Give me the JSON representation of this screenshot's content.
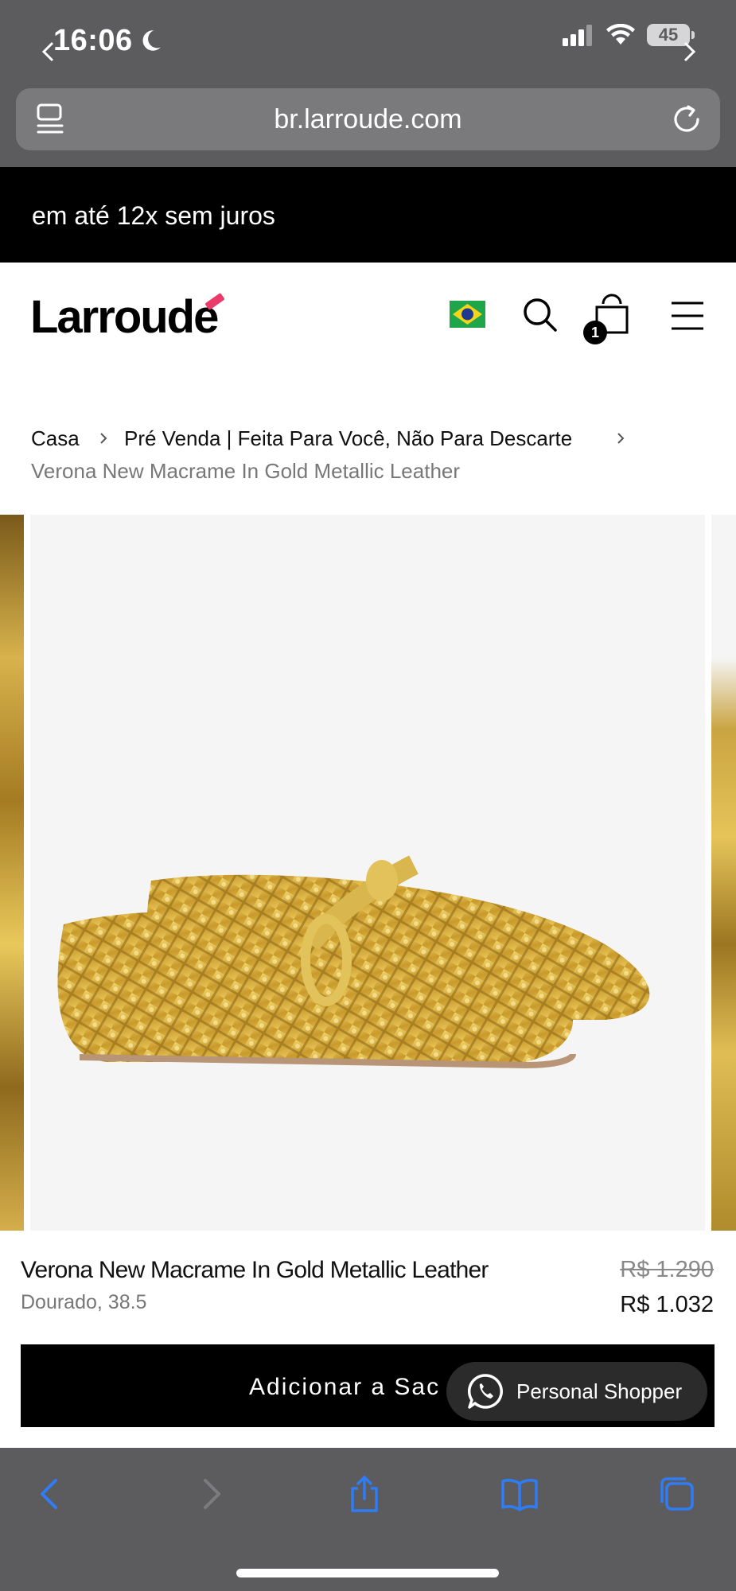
{
  "status_bar": {
    "time": "16:06",
    "battery": "45"
  },
  "browser": {
    "url": "br.larroude.com"
  },
  "promo": {
    "text": "em até 12x sem juros"
  },
  "header": {
    "logo": "Larroude",
    "bag_count": "1"
  },
  "breadcrumb": {
    "items": [
      "Casa",
      "Pré Venda | Feita Para Você, Não Para Descarte"
    ],
    "current": "Verona New Macrame In Gold Metallic Leather"
  },
  "product": {
    "name": "Verona New Macrame In Gold Metallic Leather",
    "variant": "Dourado, 38.5",
    "price_original": "R$ 1.290",
    "price_sale": "R$ 1.032"
  },
  "cta": {
    "add_to_bag": "Adicionar a Sac",
    "personal_shopper": "Personal Shopper"
  },
  "colors": {
    "chrome": "#5c5c5e",
    "accent_link": "#2f7df6",
    "logo_accent": "#ea3b6a",
    "gold": "#d9b54a"
  }
}
